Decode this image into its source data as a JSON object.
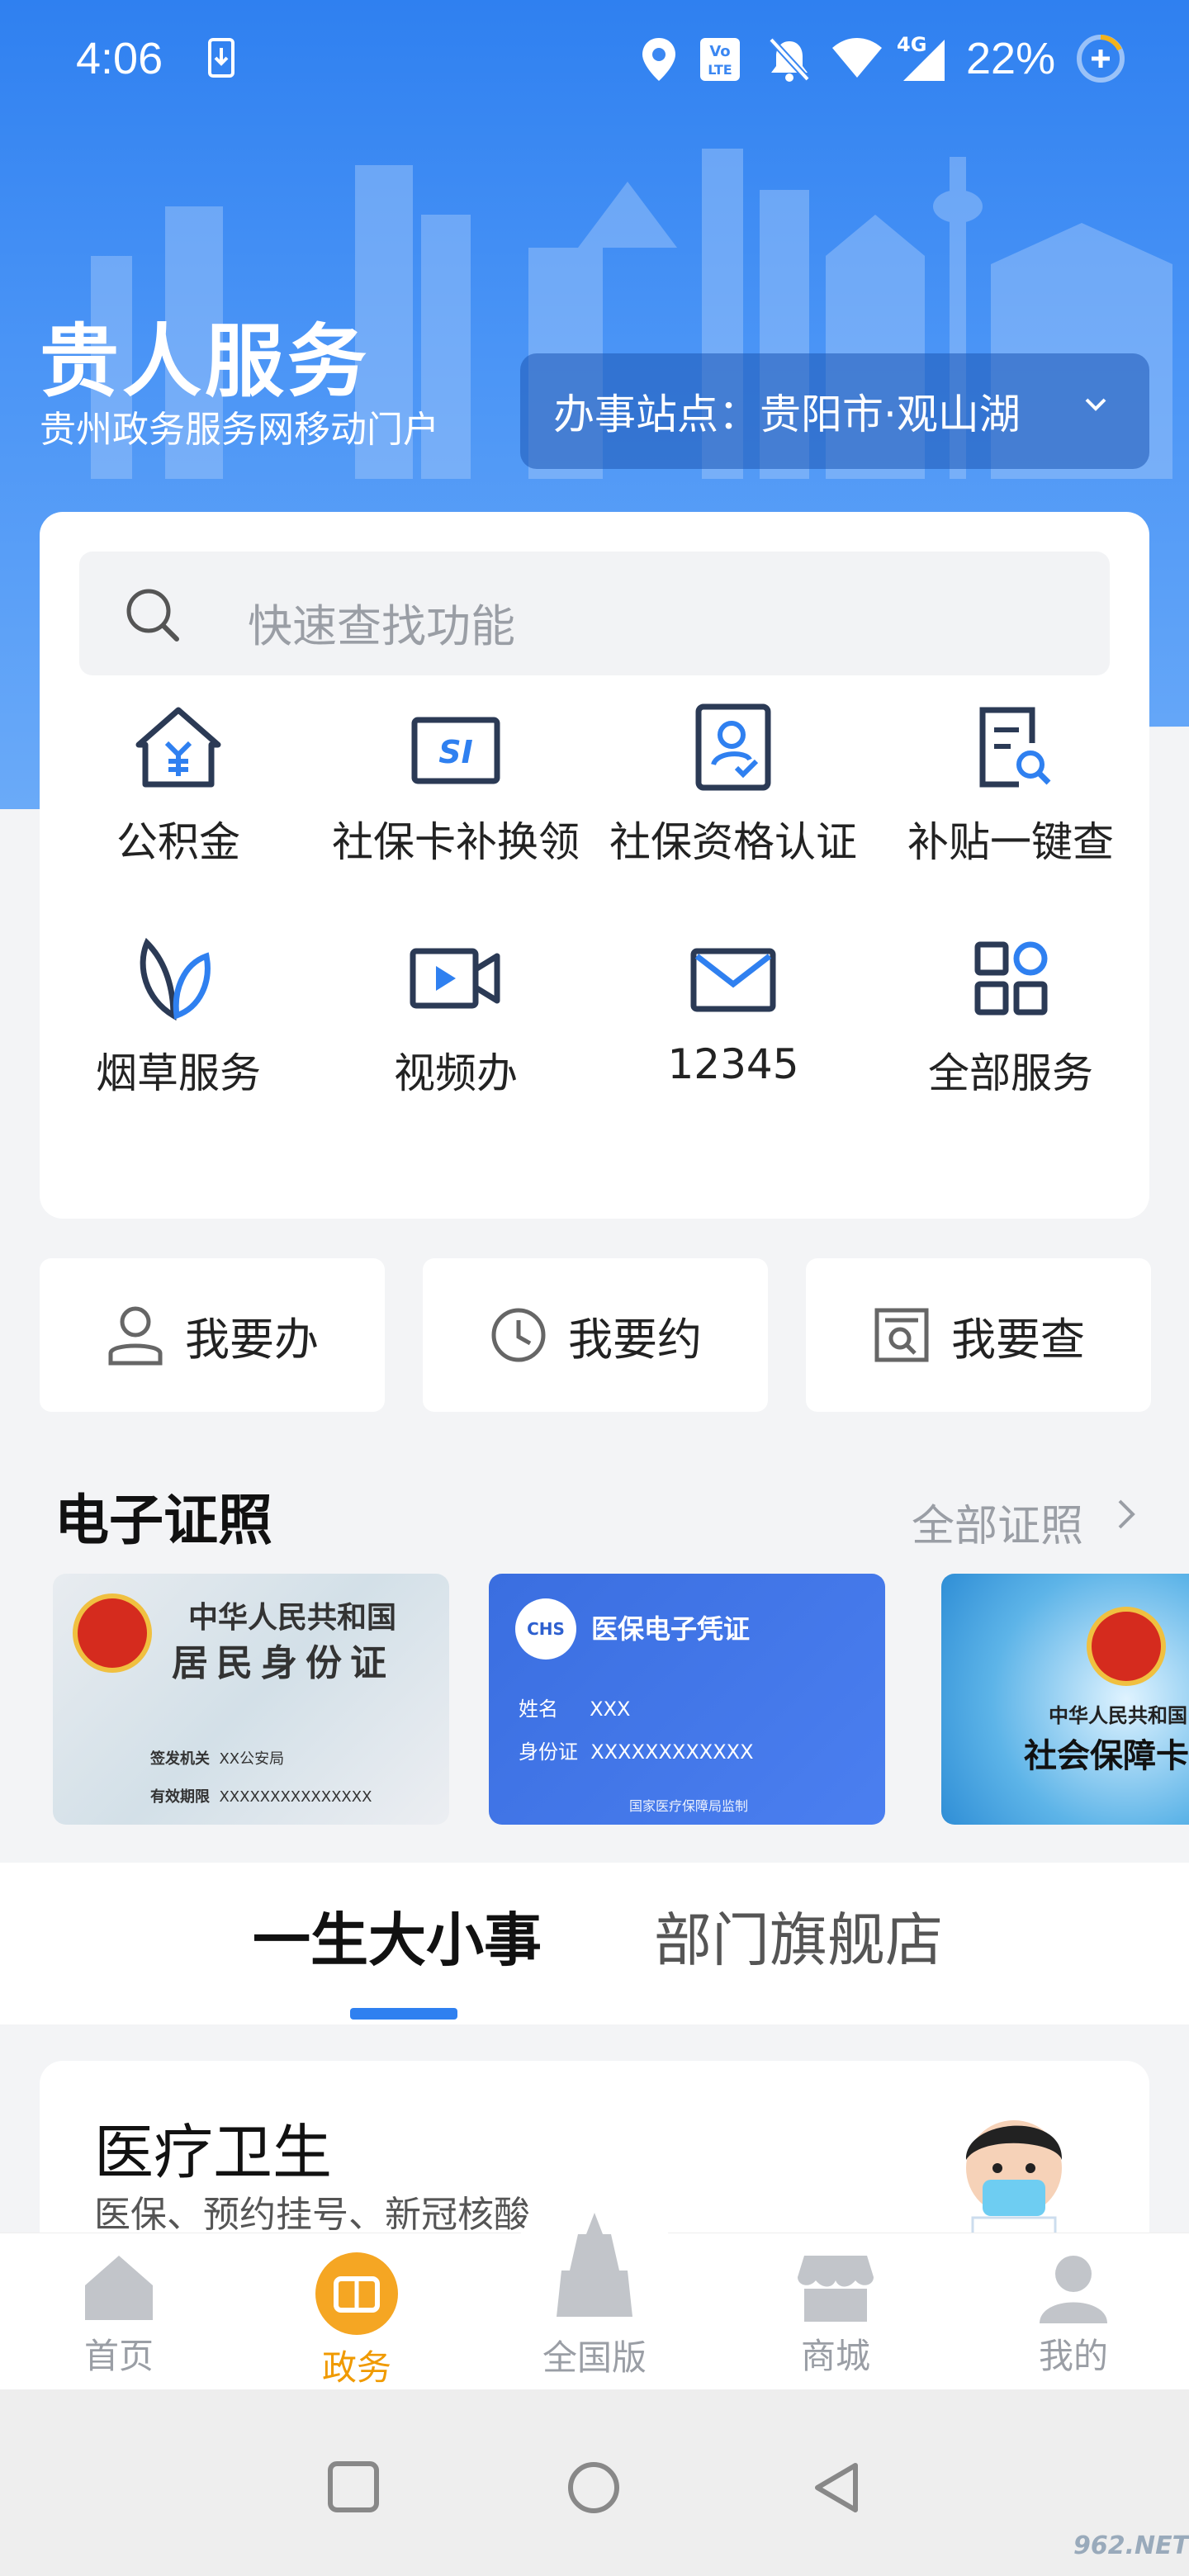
{
  "status_bar": {
    "time": "4:06",
    "battery": "22%",
    "network": "4G",
    "icons": [
      "download-icon",
      "location-icon",
      "volte-icon",
      "bell-off-icon",
      "wifi-icon",
      "signal-icon",
      "battery-saver-icon"
    ]
  },
  "header": {
    "title": "贵人服务",
    "subtitle": "贵州政务服务网移动门户",
    "site_selector": "办事站点：贵阳市·观山湖"
  },
  "search": {
    "placeholder": "快速查找功能"
  },
  "services": [
    {
      "label": "公积金",
      "icon": "housing-fund-icon"
    },
    {
      "label": "社保卡补换领",
      "icon": "si-card-icon"
    },
    {
      "label": "社保资格认证",
      "icon": "qualification-icon"
    },
    {
      "label": "补贴一键查",
      "icon": "subsidy-search-icon"
    },
    {
      "label": "烟草服务",
      "icon": "tobacco-leaf-icon"
    },
    {
      "label": "视频办",
      "icon": "video-icon"
    },
    {
      "label": "12345",
      "icon": "mail-icon"
    },
    {
      "label": "全部服务",
      "icon": "all-services-icon"
    }
  ],
  "quick_actions": [
    {
      "label": "我要办",
      "icon": "person-icon"
    },
    {
      "label": "我要约",
      "icon": "clock-icon"
    },
    {
      "label": "我要查",
      "icon": "doc-search-icon"
    }
  ],
  "certificates": {
    "title": "电子证照",
    "more": "全部证照",
    "id_card": {
      "line1": "中华人民共和国",
      "line2": "居民身份证",
      "authority_label": "签发机关",
      "authority_value": "XX公安局",
      "validity_label": "有效期限",
      "validity_value": "XXXXXXXXXXXXXXX"
    },
    "medical": {
      "logo": "CHS",
      "title": "医保电子凭证",
      "name_label": "姓名",
      "name_value": "XXX",
      "id_label": "身份证",
      "id_value": "XXXXXXXXXXXX",
      "footer": "国家医疗保障局监制"
    },
    "social": {
      "line1": "中华人民共和国",
      "line2": "社会保障卡"
    }
  },
  "tabs": [
    {
      "label": "一生大小事"
    },
    {
      "label": "部门旗舰店"
    }
  ],
  "life_card": {
    "title": "医疗卫生",
    "description": "医保、预约挂号、新冠核酸..."
  },
  "bottom_nav": [
    {
      "label": "首页",
      "icon": "home-icon"
    },
    {
      "label": "政务",
      "icon": "gov-affairs-icon",
      "active": true
    },
    {
      "label": "全国版",
      "icon": "national-icon"
    },
    {
      "label": "商城",
      "icon": "store-icon"
    },
    {
      "label": "我的",
      "icon": "profile-icon"
    }
  ],
  "colors": {
    "primary": "#2f80f0",
    "active_nav": "#f09a00",
    "icon_stroke": "#2b3a55",
    "icon_accent": "#2f80f0"
  },
  "watermark": "962.NET"
}
